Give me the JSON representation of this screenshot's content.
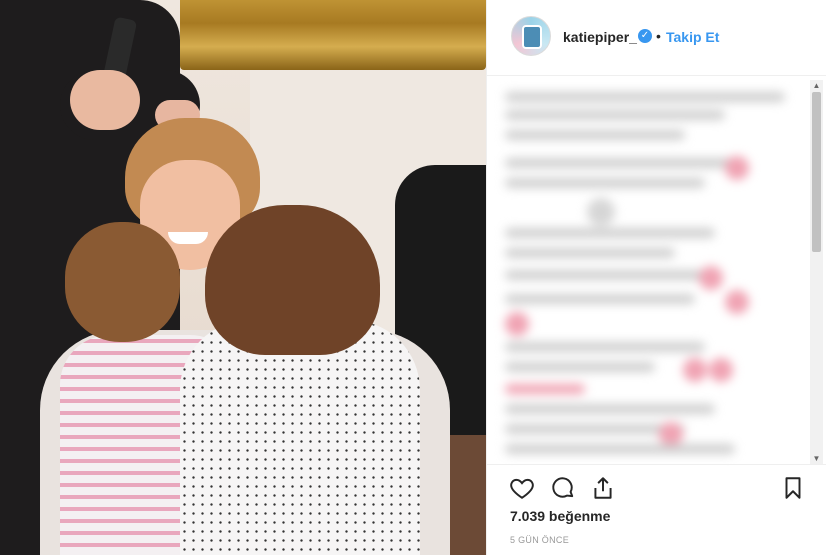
{
  "post": {
    "username": "katiepiper_",
    "verified_icon": "verified-badge-icon",
    "separator": "•",
    "follow_label": "Takip Et",
    "likes_text": "7.039 beğenme",
    "timestamp": "5 GÜN ÖNCE"
  },
  "actions": {
    "like_icon": "heart-icon",
    "comment_icon": "comment-icon",
    "share_icon": "share-icon",
    "save_icon": "bookmark-icon"
  },
  "colors": {
    "accent": "#3897f0",
    "text": "#262626",
    "muted": "#999999",
    "border": "#efefef"
  }
}
